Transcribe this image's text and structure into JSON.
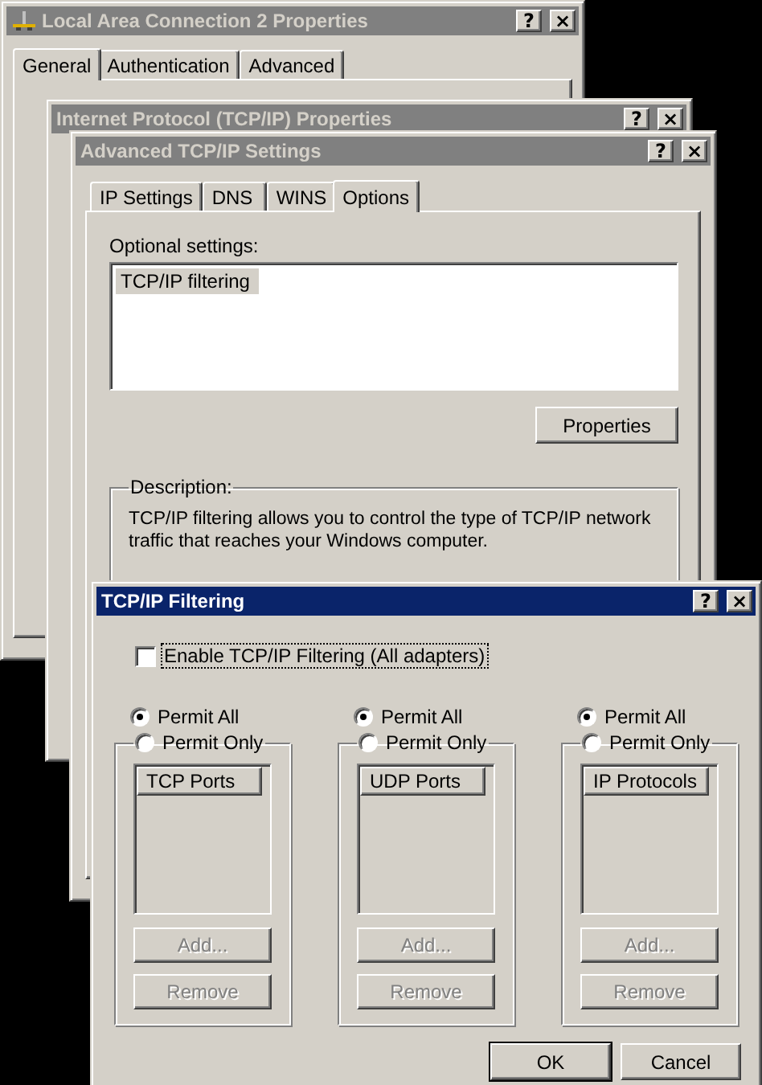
{
  "windows": [
    {
      "title": "Local Area Connection 2 Properties",
      "active": false,
      "caption_buttons": [
        "?",
        "×"
      ],
      "tabs": [
        {
          "label": "General",
          "selected": true
        },
        {
          "label": "Authentication",
          "selected": false
        },
        {
          "label": "Advanced",
          "selected": false
        }
      ]
    },
    {
      "title": "Internet Protocol (TCP/IP) Properties",
      "active": false,
      "caption_buttons": [
        "?",
        "×"
      ]
    },
    {
      "title": "Advanced TCP/IP Settings",
      "active": false,
      "caption_buttons": [
        "?",
        "×"
      ],
      "tabs": [
        {
          "label": "IP Settings",
          "selected": false
        },
        {
          "label": "DNS",
          "selected": false
        },
        {
          "label": "WINS",
          "selected": false
        },
        {
          "label": "Options",
          "selected": true
        }
      ],
      "optional_settings": {
        "label": "Optional settings:",
        "items": [
          {
            "label": "TCP/IP filtering",
            "selected": true
          }
        ]
      },
      "properties_button": "Properties",
      "description": {
        "label": "Description:",
        "text": "TCP/IP filtering allows you to control the type of TCP/IP network traffic that reaches your Windows computer."
      }
    },
    {
      "title": "TCP/IP Filtering",
      "active": true,
      "caption_buttons": [
        "?",
        "×"
      ],
      "enable_checkbox": {
        "label": "Enable TCP/IP Filtering (All adapters)",
        "checked": false
      },
      "groups": [
        {
          "options": [
            {
              "label": "Permit All",
              "selected": true
            },
            {
              "label": "Permit Only",
              "selected": false
            }
          ],
          "list_header": "TCP Ports",
          "buttons": [
            {
              "label": "Add...",
              "disabled": true
            },
            {
              "label": "Remove",
              "disabled": true
            }
          ]
        },
        {
          "options": [
            {
              "label": "Permit All",
              "selected": true
            },
            {
              "label": "Permit Only",
              "selected": false
            }
          ],
          "list_header": "UDP Ports",
          "buttons": [
            {
              "label": "Add...",
              "disabled": true
            },
            {
              "label": "Remove",
              "disabled": true
            }
          ]
        },
        {
          "options": [
            {
              "label": "Permit All",
              "selected": true
            },
            {
              "label": "Permit Only",
              "selected": false
            }
          ],
          "list_header": "IP Protocols",
          "buttons": [
            {
              "label": "Add...",
              "disabled": true
            },
            {
              "label": "Remove",
              "disabled": true
            }
          ]
        }
      ],
      "buttons": [
        "OK",
        "Cancel"
      ]
    }
  ]
}
